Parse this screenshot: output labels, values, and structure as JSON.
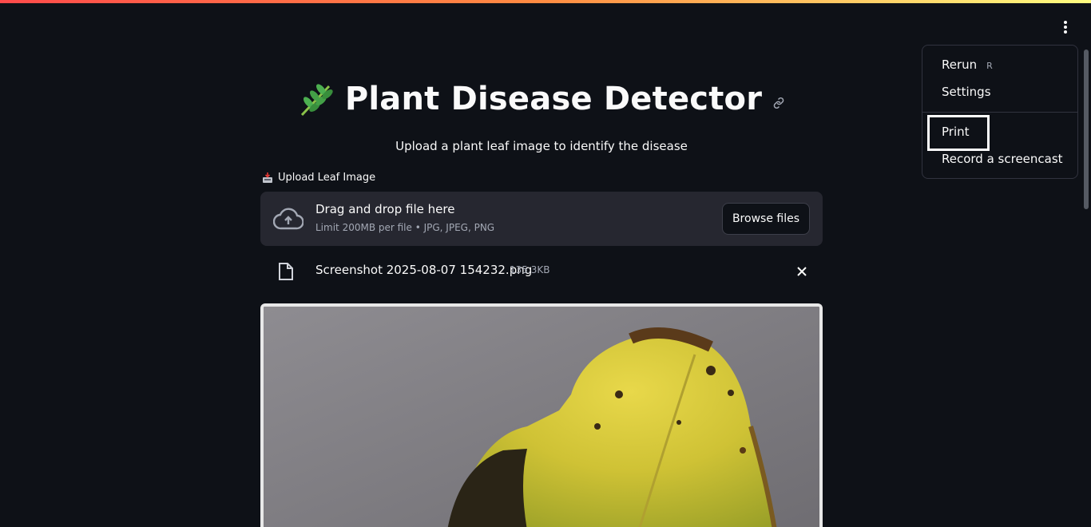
{
  "app": {
    "title": "Plant Disease Detector",
    "subtitle": "Upload a plant leaf image to identify the disease",
    "title_icon": "herb-icon"
  },
  "uploader": {
    "label": "Upload Leaf Image",
    "label_icon": "inbox-tray-icon",
    "drop_title": "Drag and drop file here",
    "drop_subtitle": "Limit 200MB per file • JPG, JPEG, PNG",
    "browse_label": "Browse files"
  },
  "uploaded_file": {
    "name": "Screenshot 2025-08-07 154232.png",
    "size": "135.3KB"
  },
  "menu": {
    "items": [
      {
        "label": "Rerun",
        "shortcut": "R"
      },
      {
        "label": "Settings"
      },
      {
        "label": "Print"
      },
      {
        "label": "Record a screencast"
      }
    ]
  },
  "colors": {
    "background": "#0e1117",
    "surface": "#262730",
    "accent_start": "#ff4b4b",
    "accent_end": "#fffd80"
  }
}
